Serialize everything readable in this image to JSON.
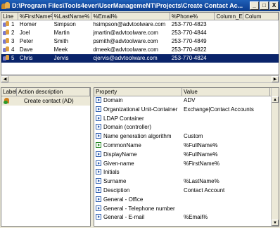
{
  "window": {
    "title": "D:\\Program Files\\Tools4ever\\UserManagemeNT\\Projects\\Create Contact Ac...",
    "minimize": "_",
    "maximize": "□",
    "close": "X"
  },
  "grid": {
    "columns": [
      "Line",
      "%FirstName%",
      "%LastName%",
      "%Email%",
      "%Phone%",
      "Column_E",
      "Colum"
    ],
    "rows": [
      {
        "line": "1",
        "first": "Homer",
        "last": "Simpson",
        "email": "hsimpson@advtoolware.com",
        "phone": "253-770-4823"
      },
      {
        "line": "2",
        "first": "Joel",
        "last": "Martin",
        "email": "jmartin@advtoolware.com",
        "phone": "253-770-4844"
      },
      {
        "line": "3",
        "first": "Peter",
        "last": "Smith",
        "email": "psmith@advtoolware.com",
        "phone": "253-770-4849"
      },
      {
        "line": "4",
        "first": "Dave",
        "last": "Meek",
        "email": "dmeek@advtoolware.com",
        "phone": "253-770-4822"
      },
      {
        "line": "5",
        "first": "Chris",
        "last": "Jervis",
        "email": "cjervis@advtoolware.com",
        "phone": "253-770-4824"
      }
    ],
    "selected_row": 5
  },
  "actions": {
    "columns": [
      "Label",
      "Action description"
    ],
    "items": [
      {
        "label": "",
        "description": "Create contact (AD)"
      }
    ]
  },
  "properties": {
    "columns": [
      "Property",
      "Value"
    ],
    "rows": [
      {
        "property": "Domain",
        "value": "ADV"
      },
      {
        "property": "Organizational Unit-Container",
        "value": "Exchange|Contact Accounts"
      },
      {
        "property": "LDAP Container",
        "value": ""
      },
      {
        "property": "Domain (controller)",
        "value": ""
      },
      {
        "property": "Name generation algorithm",
        "value": "Custom"
      },
      {
        "property": "CommonName",
        "value": "%FullName%"
      },
      {
        "property": "DisplayName",
        "value": "%FullName%"
      },
      {
        "property": "Given-name",
        "value": "%FirstName%"
      },
      {
        "property": "Initials",
        "value": ""
      },
      {
        "property": "Surname",
        "value": "%LastName%"
      },
      {
        "property": "Desciption",
        "value": "Contact Account"
      },
      {
        "property": "General - Office",
        "value": ""
      },
      {
        "property": "General - Telephone number",
        "value": ""
      },
      {
        "property": "General - E-mail",
        "value": "%Email%"
      }
    ]
  }
}
